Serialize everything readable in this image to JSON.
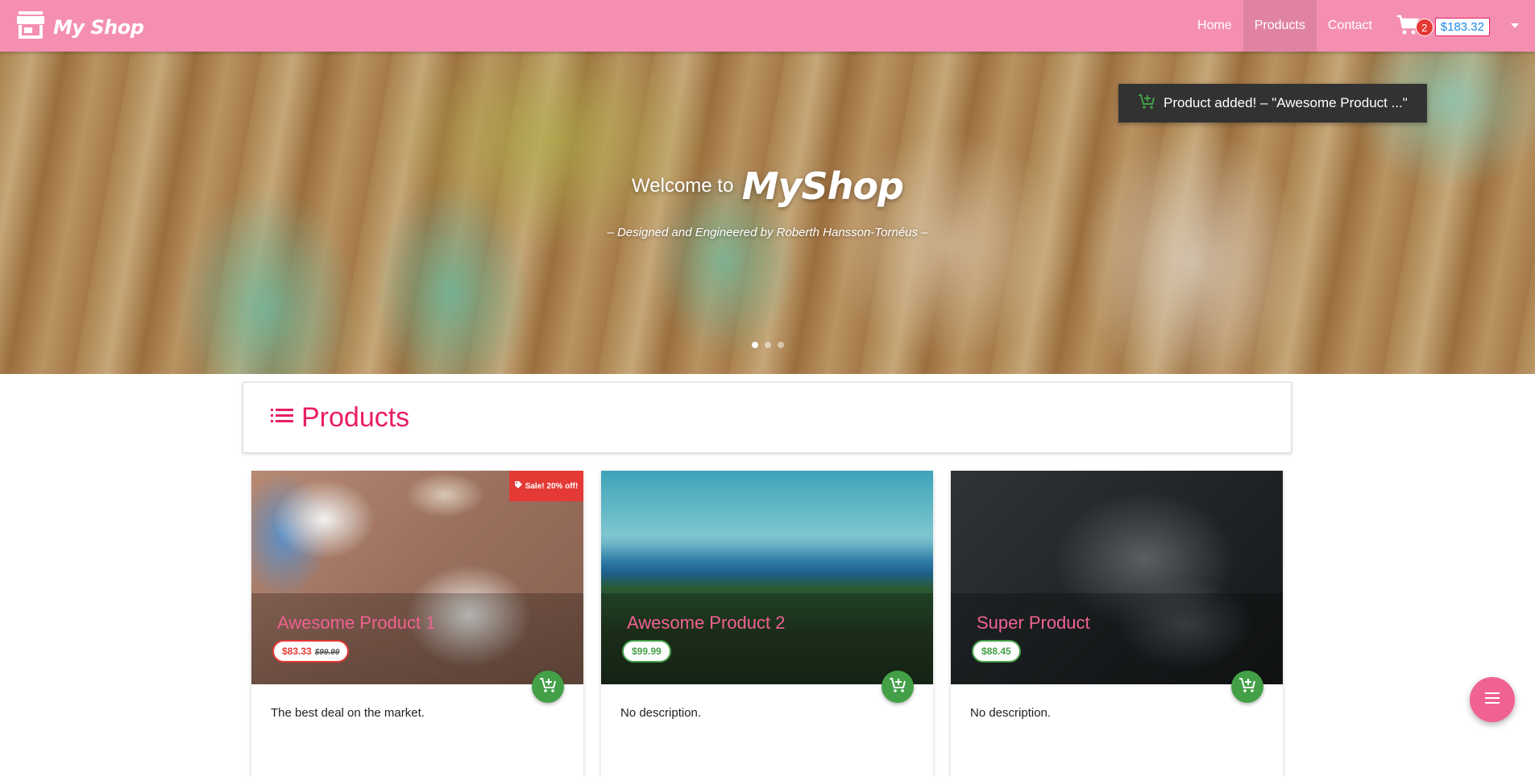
{
  "header": {
    "brand": "My Shop",
    "nav": [
      "Home",
      "Products",
      "Contact"
    ],
    "active_nav": "Products",
    "cart_count": "2",
    "cart_total": "$183.32"
  },
  "hero": {
    "welcome": "Welcome to",
    "logo": "MyShop",
    "subtitle": "– Designed and Engineered by Roberth Hansson-Tornéus –",
    "slides": 3,
    "active_slide": 1
  },
  "toast": {
    "message": "Product added! – \"Awesome Product ...\""
  },
  "products_section": {
    "title": "Products"
  },
  "products": [
    {
      "name": "Awesome Product 1",
      "price": "$83.33",
      "old_price": "$99.99",
      "sale_label": "Sale! 20% off!",
      "description": "The best deal on the market."
    },
    {
      "name": "Awesome Product 2",
      "price": "$99.99",
      "description": "No description."
    },
    {
      "name": "Super Product",
      "price": "$88.45",
      "description": "No description."
    }
  ],
  "colors": {
    "primary": "#f48fb1",
    "accent": "#e91e63",
    "success": "#43a047",
    "sale": "#e53935"
  },
  "icons": [
    "store-icon",
    "cart-icon",
    "add-to-cart-icon",
    "list-icon",
    "tag-icon",
    "menu-icon"
  ]
}
